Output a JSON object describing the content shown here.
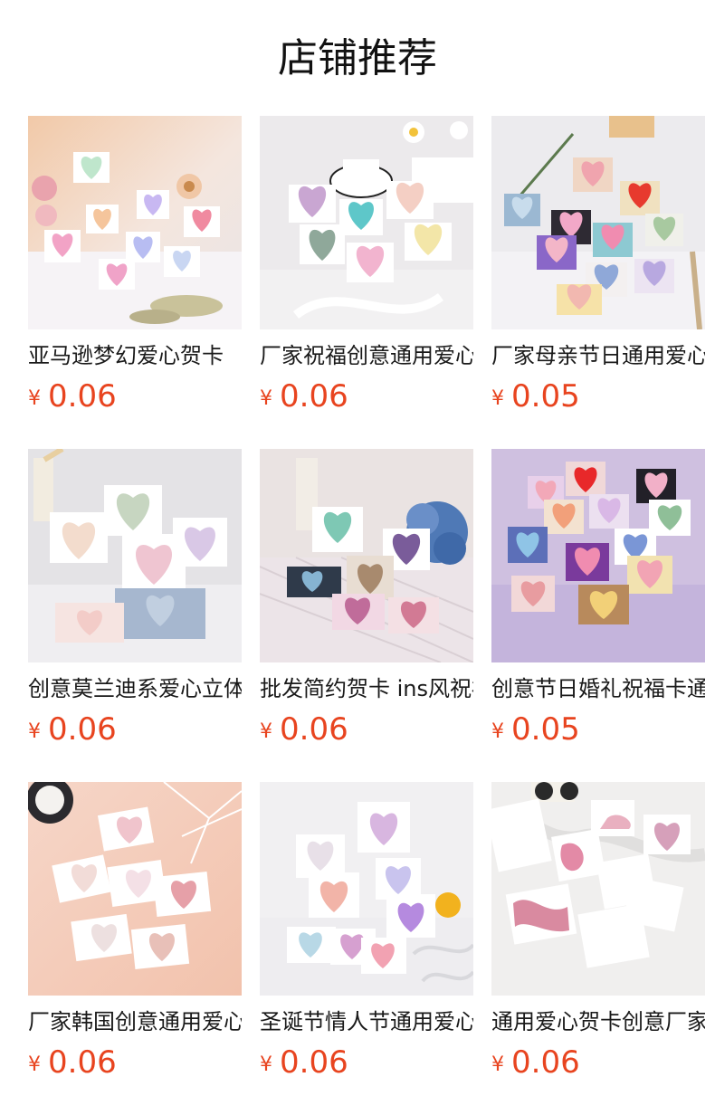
{
  "header": {
    "title": "店铺推荐"
  },
  "currency_symbol": "¥",
  "products": [
    {
      "name": "亚马逊梦幻爱心贺卡",
      "price": "0.06",
      "image": "ombre-heart-greeting-cards-flowers-icon"
    },
    {
      "name": "厂家祝福创意通用爱心贺卡",
      "price": "0.06",
      "image": "pastel-heart-cards-teacup-icon"
    },
    {
      "name": "厂家母亲节日通用爱心贺卡",
      "price": "0.05",
      "image": "colorful-heart-cards-vase-icon"
    },
    {
      "name": "创意莫兰迪系爱心立体贺卡",
      "price": "0.06",
      "image": "morandi-heart-standing-cards-icon"
    },
    {
      "name": "批发简约贺卡 ins风祝福卡",
      "price": "0.06",
      "image": "simple-heart-cards-hydrangea-icon"
    },
    {
      "name": "创意节日婚礼祝福卡通用",
      "price": "0.05",
      "image": "wedding-heart-cards-purple-icon"
    },
    {
      "name": "厂家韩国创意通用爱心贺卡",
      "price": "0.06",
      "image": "watercolor-heart-cards-peach-icon"
    },
    {
      "name": "圣诞节情人节通用爱心贺卡",
      "price": "0.06",
      "image": "gradient-heart-cards-lace-icon"
    },
    {
      "name": "通用爱心贺卡创意厂家批发",
      "price": "0.06",
      "image": "marble-heart-cards-fur-icon"
    }
  ],
  "colors": {
    "price": "#e8441f",
    "title": "#111111"
  }
}
